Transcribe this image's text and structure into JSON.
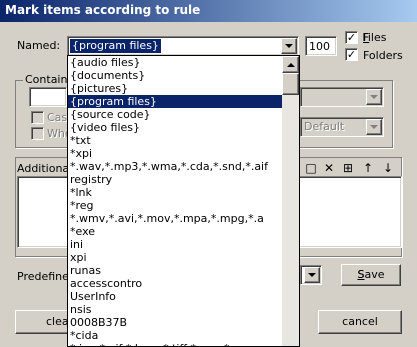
{
  "window": {
    "title": "Mark items according to rule"
  },
  "named": {
    "label": "Named:",
    "value": "{program files}",
    "count": "100",
    "files_label": "Files",
    "files_checked": true,
    "folders_label": "Folders",
    "folders_checked": true
  },
  "contains": {
    "group_label": "Contain",
    "case_label": "Cas",
    "whole_label": "Whe",
    "encoding_value": "Default"
  },
  "additional": {
    "group_label": "Additiona"
  },
  "predefined": {
    "label": "Predefine",
    "save_label": "Save"
  },
  "buttons": {
    "clear_label": "clea",
    "cancel_label": "cancel"
  },
  "dropdown": {
    "items": [
      "{audio files}",
      "{documents}",
      "{pictures}",
      "{program files}",
      "{source code}",
      "{video files}",
      "*txt",
      "*xpi",
      "*.wav,*.mp3,*.wma,*.cda,*.snd,*.aif",
      "registry",
      "*lnk",
      "*reg",
      "*.wmv,*.avi,*.mov,*.mpa,*.mpg,*.a",
      "*exe",
      "ini",
      "xpi",
      "runas",
      "accesscontro",
      "UserInfo",
      "nsis",
      "0008B37B",
      "*cida",
      "*.jpg,*.gif,*.bmp,*.tiff,*.png,*.ps"
    ],
    "selected_index": 3
  },
  "icons": {
    "toolbar": [
      "new-icon",
      "delete-icon",
      "properties-icon",
      "move-up-icon",
      "move-down-icon"
    ]
  },
  "toolbar_glyphs": [
    "□",
    "✕",
    "⊞",
    "↑",
    "↓"
  ]
}
